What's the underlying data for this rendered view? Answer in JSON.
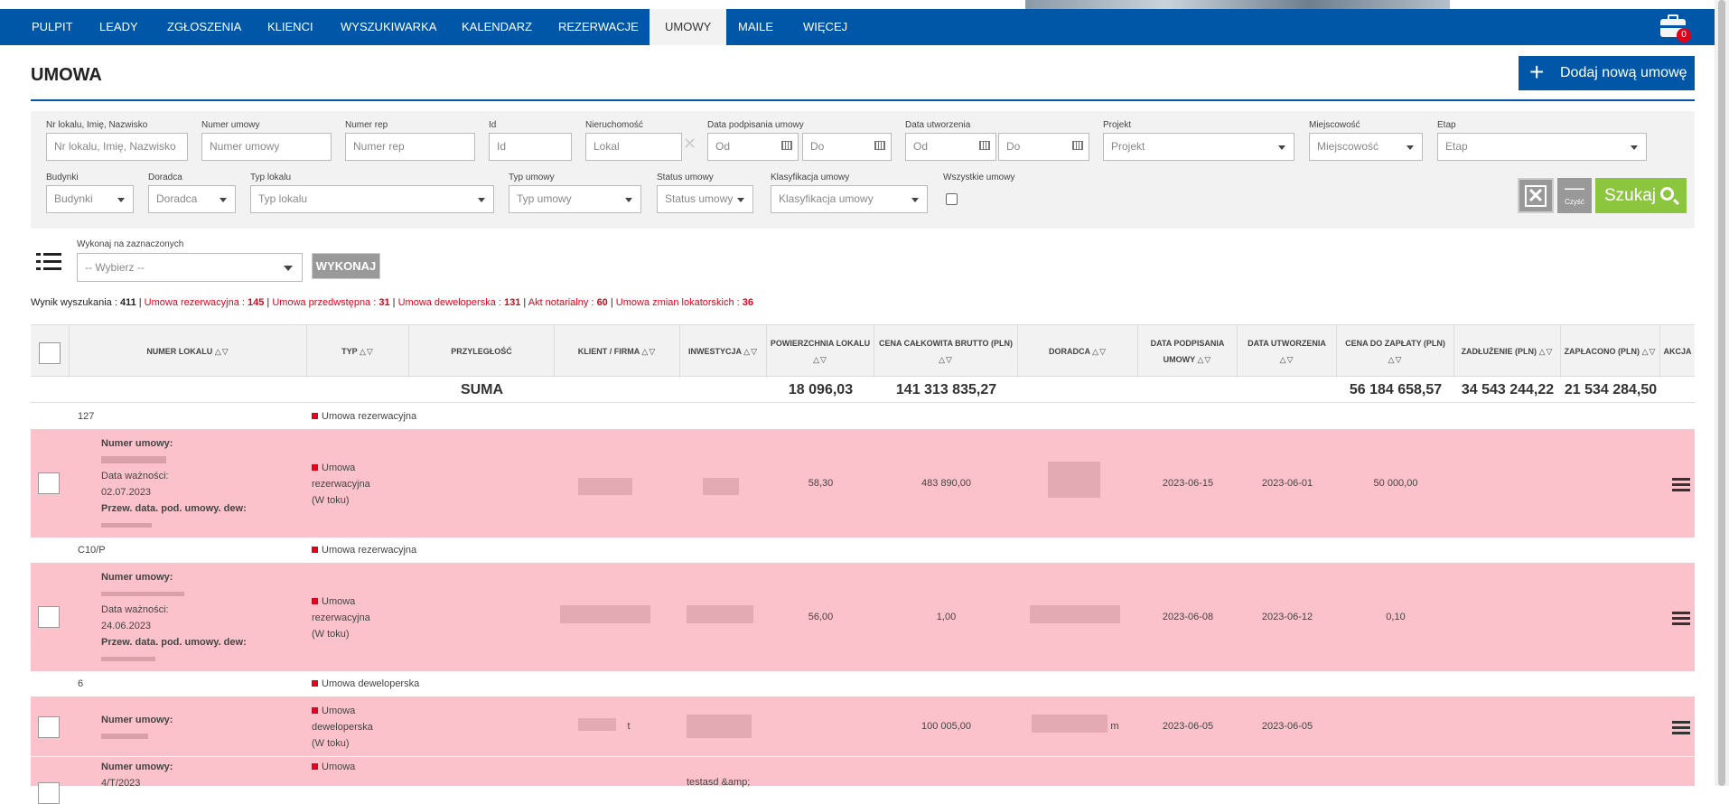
{
  "nav": {
    "items": [
      "PULPIT",
      "LEADY",
      "ZGŁOSZENIA",
      "KLIENCI",
      "WYSZUKIWARKA",
      "KALENDARZ",
      "REZERWACJE",
      "UMOWY",
      "MAILE",
      "WIĘCEJ"
    ],
    "active": "UMOWY",
    "badge": "0"
  },
  "header": {
    "title": "UMOWA",
    "add_button": "Dodaj nową umowę"
  },
  "filters": {
    "nr_lokalu": {
      "label": "Nr lokalu, Imię, Nazwisko",
      "placeholder": "Nr lokalu, Imię, Nazwisko"
    },
    "numer_umowy": {
      "label": "Numer umowy",
      "placeholder": "Numer umowy"
    },
    "numer_rep": {
      "label": "Numer rep",
      "placeholder": "Numer rep"
    },
    "id": {
      "label": "Id",
      "placeholder": "Id"
    },
    "nieruchomosc": {
      "label": "Nieruchomość",
      "placeholder": "Lokal"
    },
    "data_podpisania": {
      "label": "Data podpisania umowy",
      "from": "Od",
      "to": "Do"
    },
    "data_utworzenia": {
      "label": "Data utworzenia",
      "from": "Od",
      "to": "Do"
    },
    "projekt": {
      "label": "Projekt",
      "value": "Projekt"
    },
    "miejscowosc": {
      "label": "Miejscowość",
      "value": "Miejscowość"
    },
    "etap": {
      "label": "Etap",
      "value": "Etap"
    },
    "budynki": {
      "label": "Budynki",
      "value": "Budynki"
    },
    "doradca": {
      "label": "Doradca",
      "value": "Doradca"
    },
    "typ_lokalu": {
      "label": "Typ lokalu",
      "value": "Typ lokalu"
    },
    "typ_umowy": {
      "label": "Typ umowy",
      "value": "Typ umowy"
    },
    "status_umowy": {
      "label": "Status umowy",
      "value": "Status umowy"
    },
    "klasyfikacja": {
      "label": "Klasyfikacja umowy",
      "value": "Klasyfikacja umowy"
    },
    "wszystkie": {
      "label": "Wszystkie umowy"
    },
    "clear_label": "Czyść",
    "search_label": "Szukaj"
  },
  "bulk": {
    "label": "Wykonaj na zaznaczonych",
    "select_value": "-- Wybierz --",
    "execute": "WYKONAJ"
  },
  "results": {
    "total_label": "Wynik wyszukania :",
    "total": "411",
    "rezerwacyjna_label": "Umowa rezerwacyjna :",
    "rezerwacyjna": "145",
    "przedwstepna_label": "Umowa przedwstępna :",
    "przedwstepna": "31",
    "deweloperska_label": "Umowa deweloperska :",
    "deweloperska": "131",
    "notarialny_label": "Akt notarialny :",
    "notarialny": "60",
    "zmian_label": "Umowa zmian lokatorskich :",
    "zmian": "36"
  },
  "table": {
    "columns": [
      "NUMER LOKALU",
      "TYP",
      "PRZYLEGŁOŚĆ",
      "KLIENT / FIRMA",
      "INWESTYCJA",
      "POWIERZCHNIA LOKALU",
      "CENA CAŁKOWITA BRUTTO (PLN)",
      "DORADCA",
      "DATA PODPISANIA UMOWY",
      "DATA UTWORZENIA",
      "CENA DO ZAPŁATY (PLN)",
      "ZADŁUŻENIE (PLN)",
      "ZAPŁACONO (PLN)",
      "AKCJA"
    ],
    "sum": {
      "label": "SUMA",
      "powierzchnia": "18 096,03",
      "cena_calkowita": "141 313 835,27",
      "cena_do_zaplaty": "56 184 658,57",
      "zadluzenie": "34 543 244,22",
      "zaplacono": "21 534 284,50"
    },
    "groups": [
      {
        "lokal": "127",
        "type": "Umowa rezerwacyjna",
        "row": {
          "numer_label": "Numer umowy:",
          "waznosc_label": "Data ważności:",
          "waznosc": "02.07.2023",
          "przew_label": "Przew. data. pod. umowy. dew:",
          "typ_lines": [
            "Umowa",
            "rezerwacyjna",
            "(W toku)"
          ],
          "powierzchnia": "58,30",
          "cena": "483 890,00",
          "data_podpisania": "2023-06-15",
          "data_utworzenia": "2023-06-01",
          "do_zaplaty": "50 000,00"
        }
      },
      {
        "lokal": "C10/P",
        "type": "Umowa rezerwacyjna",
        "row": {
          "numer_label": "Numer umowy:",
          "waznosc_label": "Data ważności:",
          "waznosc": "24.06.2023",
          "przew_label": "Przew. data. pod. umowy. dew:",
          "typ_lines": [
            "Umowa",
            "rezerwacyjna",
            "(W toku)"
          ],
          "powierzchnia": "56,00",
          "cena": "1,00",
          "data_podpisania": "2023-06-08",
          "data_utworzenia": "2023-06-12",
          "do_zaplaty": "0,10"
        }
      },
      {
        "lokal": "6",
        "type": "Umowa deweloperska",
        "row": {
          "numer_label": "Numer umowy:",
          "typ_lines": [
            "Umowa",
            "deweloperska",
            "(W toku)"
          ],
          "klient_suffix": "t",
          "doradca_suffix": "m",
          "cena": "100 005,00",
          "data_podpisania": "2023-06-05",
          "data_utworzenia": "2023-06-05"
        }
      }
    ],
    "partial_row": {
      "numer_label": "Numer umowy:",
      "numer": "4/T/2023",
      "typ": "Umowa",
      "inwestycja": "testasd &amp;"
    }
  }
}
